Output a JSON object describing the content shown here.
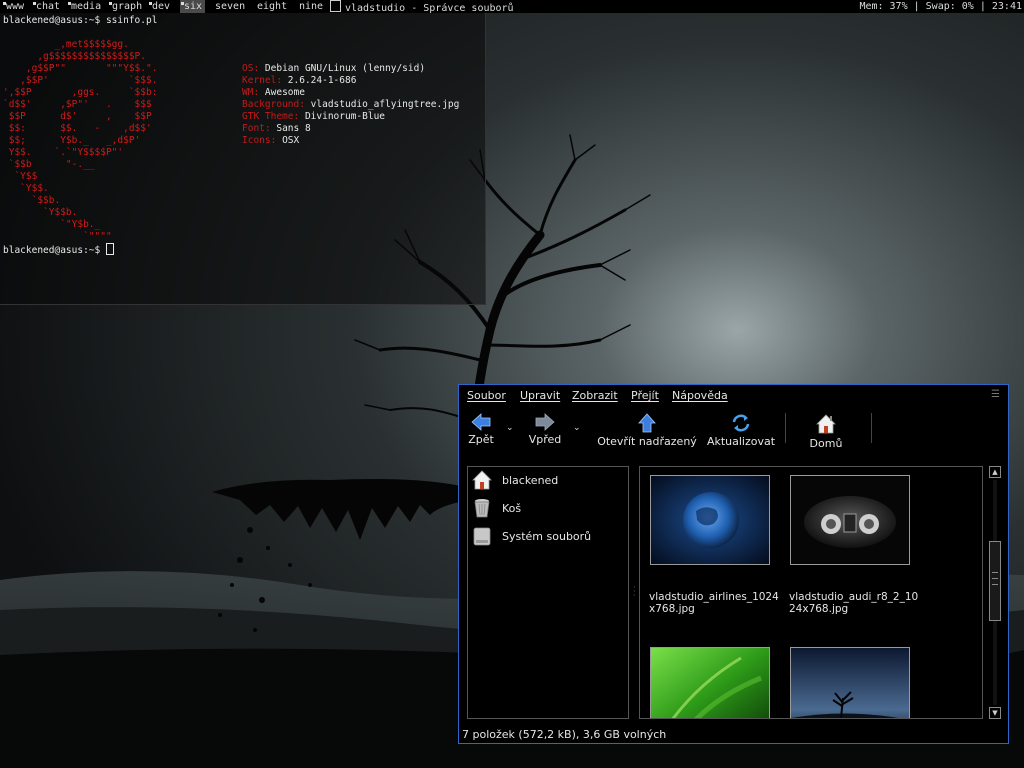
{
  "topbar": {
    "tags": [
      "www",
      "chat",
      "media",
      "graph",
      "dev",
      "six",
      "seven",
      "eight",
      "nine"
    ],
    "selected_tag": "six",
    "window_title": "vladstudio - Správce souborů",
    "status": "Mem: 37% | Swap: 0% | 23:41"
  },
  "terminal": {
    "prompt": "blackened@asus:~$ ",
    "command": "ssinfo.pl",
    "ascii_art": "         _,met$$$$$gg.\n      ,g$$$$$$$$$$$$$$$P.\n    ,g$$P\"\"       \"\"\"Y$$.\".\n   ,$$P'              `$$$.\n',$$P       ,ggs.     `$$b:\n`d$$'     ,$P\"'   .    $$$\n $$P      d$'     ,    $$P\n $$:      $$.   -    ,d$$'\n $$;      Y$b._   _,d$P'\n Y$$.    `.`\"Y$$$$P\"'\n `$$b      \"-.__\n  `Y$$\n   `Y$$.\n     `$$b.\n       `Y$$b.\n          `\"Y$b._\n              `\"\"\"\"",
    "info": [
      {
        "key": "OS:",
        "value": "Debian GNU/Linux (lenny/sid)"
      },
      {
        "key": "Kernel:",
        "value": "2.6.24-1-686"
      },
      {
        "key": "WM:",
        "value": "Awesome"
      },
      {
        "key": "Background:",
        "value": "vladstudio_aflyingtree.jpg"
      },
      {
        "key": "GTK Theme:",
        "value": "Divinorum-Blue"
      },
      {
        "key": "Font:",
        "value": "Sans 8"
      },
      {
        "key": "Icons:",
        "value": "OSX"
      }
    ]
  },
  "filemanager": {
    "menu": [
      "Soubor",
      "Upravit",
      "Zobrazit",
      "Přejít",
      "Nápověda"
    ],
    "toolbar": {
      "back": "Zpět",
      "forward": "Vpřed",
      "up": "Otevřít nadřazený",
      "refresh": "Aktualizovat",
      "home": "Domů"
    },
    "sidebar": [
      "blackened",
      "Koš",
      "Systém souborů"
    ],
    "files": [
      {
        "name": "vladstudio_airlines_1024x768.jpg"
      },
      {
        "name": "vladstudio_audi_r8_2_1024x768.jpg"
      },
      {
        "name": ""
      },
      {
        "name": ""
      }
    ],
    "status": "7 položek (572,2 kB), 3,6 GB volných"
  },
  "colors": {
    "accent": "#2f64c8",
    "terminal_key": "#c21a1a",
    "debian_red": "#d21a1a"
  }
}
